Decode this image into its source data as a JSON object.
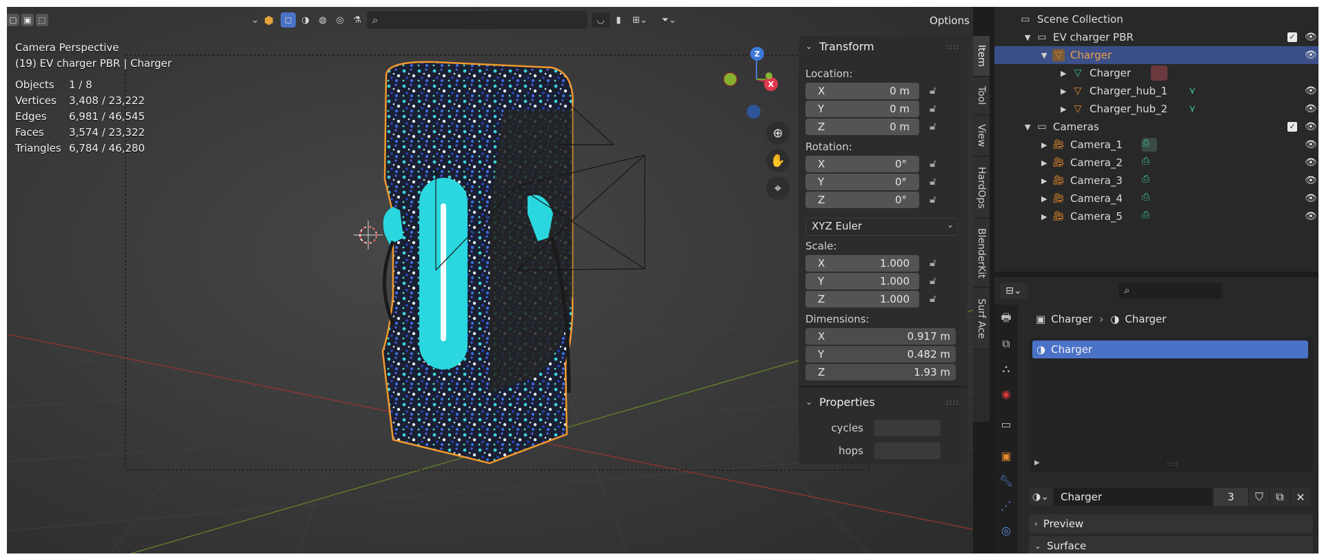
{
  "viewport": {
    "options_label": "Options",
    "overlay": {
      "title": "Camera Perspective",
      "context": "(19) EV charger PBR | Charger",
      "stats": [
        {
          "key": "Objects",
          "value": "1 / 8"
        },
        {
          "key": "Vertices",
          "value": "3,408 / 23,222"
        },
        {
          "key": "Edges",
          "value": "6,981 / 46,545"
        },
        {
          "key": "Faces",
          "value": "3,574 / 23,322"
        },
        {
          "key": "Triangles",
          "value": "6,784 / 46,280"
        }
      ]
    },
    "gizmo": {
      "z_label": "Z",
      "x_label": "X"
    }
  },
  "npanel": {
    "transform_header": "Transform",
    "location_label": "Location:",
    "location": [
      {
        "axis": "X",
        "value": "0 m"
      },
      {
        "axis": "Y",
        "value": "0 m"
      },
      {
        "axis": "Z",
        "value": "0 m"
      }
    ],
    "rotation_label": "Rotation:",
    "rotation": [
      {
        "axis": "X",
        "value": "0°"
      },
      {
        "axis": "Y",
        "value": "0°"
      },
      {
        "axis": "Z",
        "value": "0°"
      }
    ],
    "rotation_mode": "XYZ Euler",
    "scale_label": "Scale:",
    "scale": [
      {
        "axis": "X",
        "value": "1.000"
      },
      {
        "axis": "Y",
        "value": "1.000"
      },
      {
        "axis": "Z",
        "value": "1.000"
      }
    ],
    "dimensions_label": "Dimensions:",
    "dimensions": [
      {
        "axis": "X",
        "value": "0.917 m"
      },
      {
        "axis": "Y",
        "value": "0.482 m"
      },
      {
        "axis": "Z",
        "value": "1.93 m"
      }
    ],
    "properties_header": "Properties",
    "custom_props": [
      {
        "label": "cycles"
      },
      {
        "label": "hops"
      }
    ],
    "tabs": [
      "Item",
      "Tool",
      "View",
      "HardOps",
      "BlenderKit",
      "Surf Ace"
    ]
  },
  "outliner": {
    "rows": [
      {
        "label": "Scene Collection"
      },
      {
        "label": "EV charger PBR"
      },
      {
        "label": "Charger"
      },
      {
        "label": "Charger"
      },
      {
        "label": "Charger_hub_1"
      },
      {
        "label": "Charger_hub_2"
      },
      {
        "label": "Cameras"
      },
      {
        "label": "Camera_1"
      },
      {
        "label": "Camera_2"
      },
      {
        "label": "Camera_3"
      },
      {
        "label": "Camera_4"
      },
      {
        "label": "Camera_5"
      }
    ]
  },
  "properties": {
    "breadcrumb_object": "Charger",
    "breadcrumb_material": "Charger",
    "slot_name": "Charger",
    "material_name": "Charger",
    "user_count": "3",
    "preview_label": "Preview",
    "surface_label": "Surface"
  },
  "colors": {
    "selection": "#3b5088",
    "object_orange": "#e58a2a",
    "mesh_green": "#3cc7a3",
    "charger_cyan": "#2ad7df",
    "active_slot": "#4a72c7"
  }
}
